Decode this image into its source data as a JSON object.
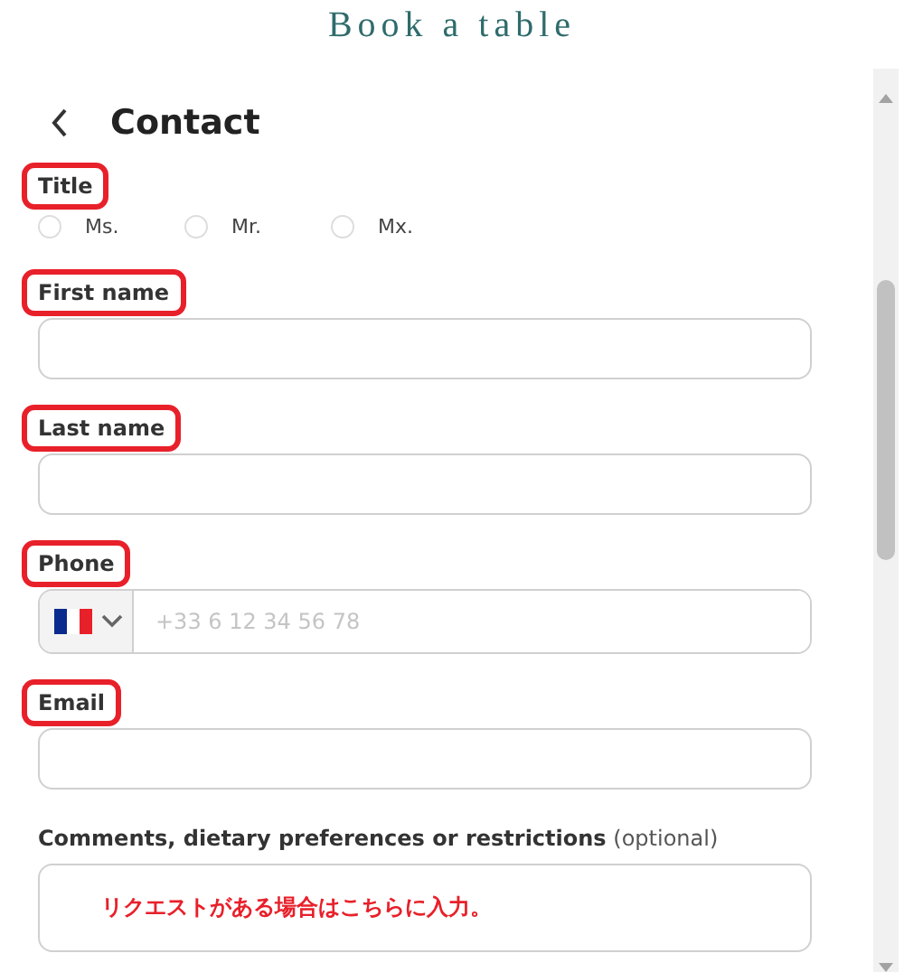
{
  "header": {
    "title": "Book a table"
  },
  "section": {
    "title": "Contact"
  },
  "fields": [
    {
      "kind": "radio",
      "label": "Title",
      "highlighted": true,
      "options": [
        {
          "label": "Ms.",
          "selected": false
        },
        {
          "label": "Mr.",
          "selected": false
        },
        {
          "label": "Mx.",
          "selected": false
        }
      ]
    },
    {
      "kind": "text",
      "label": "First name",
      "highlighted": true
    },
    {
      "kind": "text",
      "label": "Last name",
      "highlighted": true
    },
    {
      "kind": "phone",
      "label": "Phone",
      "highlighted": true,
      "placeholder": "+33 6 12 34 56 78"
    },
    {
      "kind": "text",
      "label": "Email",
      "highlighted": true
    },
    {
      "kind": "textarea",
      "label": "Comments, dietary preferences or restrictions",
      "note": "(optional)",
      "highlighted": false,
      "annotation": "リクエストがある場合はこちらに入力。"
    }
  ]
}
